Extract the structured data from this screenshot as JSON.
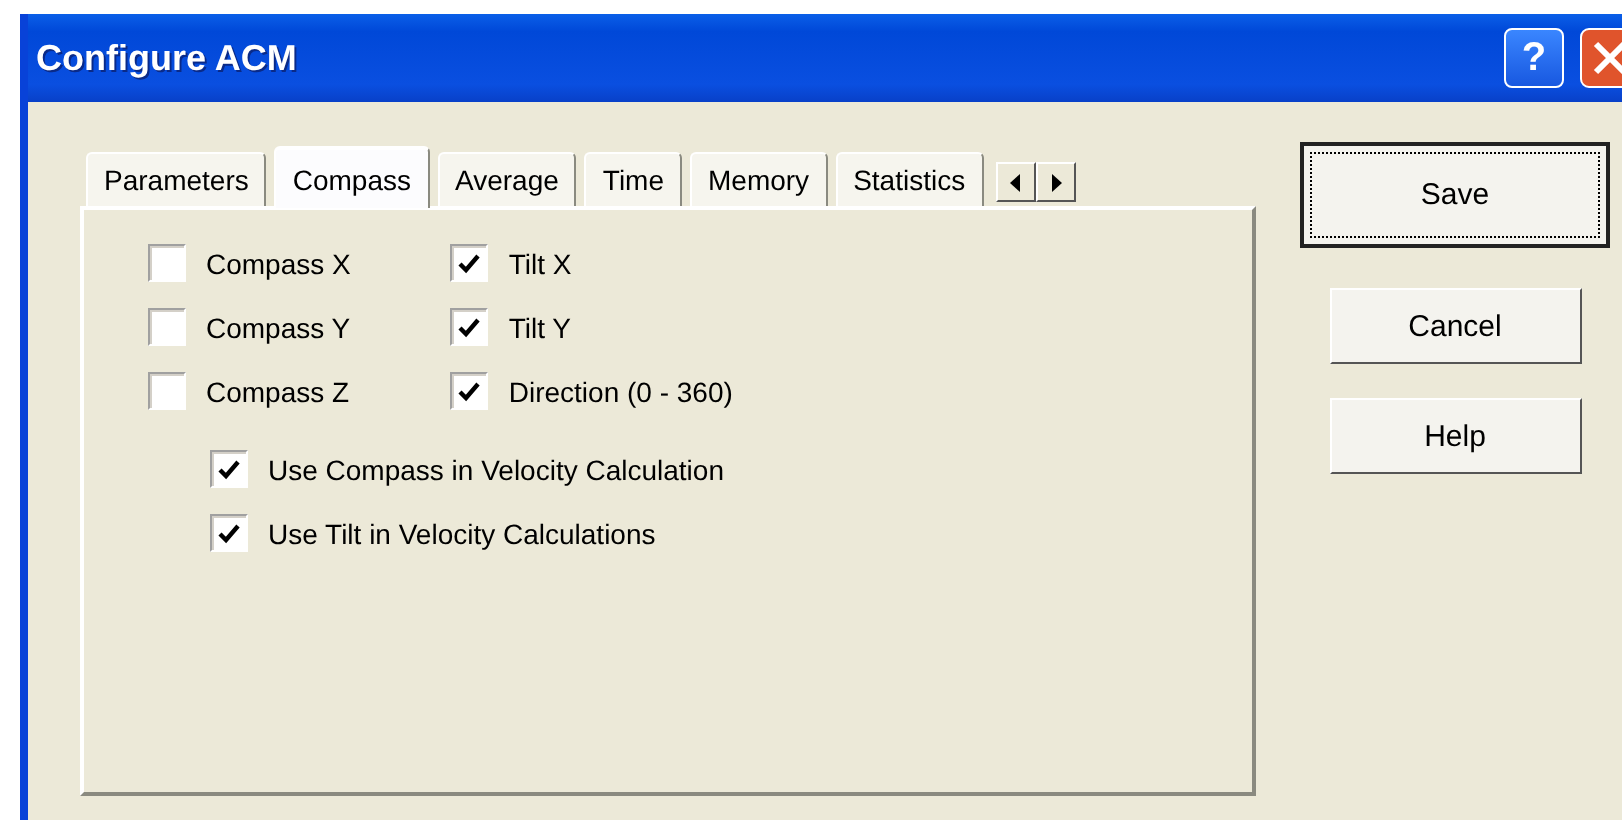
{
  "window": {
    "title": "Configure ACM",
    "help_button": "?"
  },
  "tabs": [
    {
      "label": "Parameters",
      "selected": false
    },
    {
      "label": "Compass",
      "selected": true
    },
    {
      "label": "Average",
      "selected": false
    },
    {
      "label": "Time",
      "selected": false
    },
    {
      "label": "Memory",
      "selected": false
    },
    {
      "label": "Statistics",
      "selected": false
    }
  ],
  "sensor_columns": [
    [
      {
        "label": "Compass X",
        "checked": false
      },
      {
        "label": "Compass Y",
        "checked": false
      },
      {
        "label": "Compass Z",
        "checked": false
      }
    ],
    [
      {
        "label": "Tilt X",
        "checked": true
      },
      {
        "label": "Tilt Y",
        "checked": true
      },
      {
        "label": "Direction (0 - 360)",
        "checked": true
      }
    ]
  ],
  "options": [
    {
      "label": "Use Compass in Velocity Calculation",
      "checked": true
    },
    {
      "label": "Use Tilt in Velocity Calculations",
      "checked": true
    }
  ],
  "buttons": [
    {
      "label": "Save",
      "default": true
    },
    {
      "label": "Cancel",
      "default": false
    },
    {
      "label": "Help",
      "default": false
    }
  ]
}
